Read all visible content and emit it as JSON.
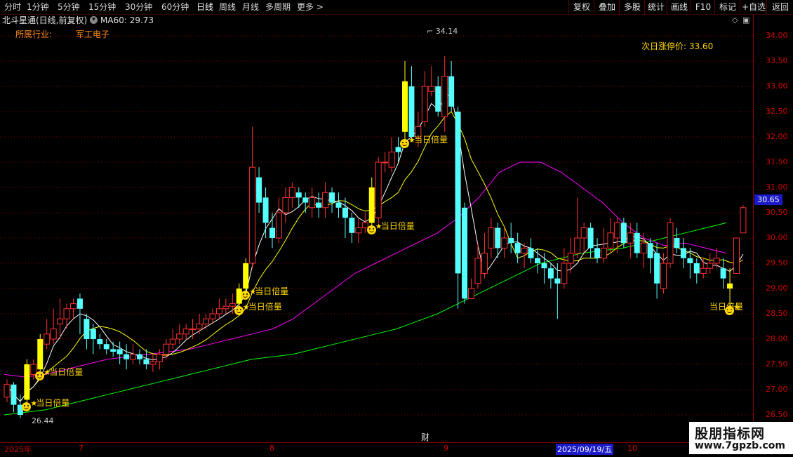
{
  "toolbar": {
    "periods": [
      "分时",
      "1分钟",
      "5分钟",
      "15分钟",
      "30分钟",
      "60分钟",
      "日线",
      "周线",
      "月线",
      "多周期",
      "更多 >"
    ],
    "active_period": "日线",
    "right_buttons": [
      "复权",
      "叠加",
      "多股",
      "统计",
      "画线",
      "F10",
      "标记",
      "+自选",
      "返回"
    ]
  },
  "title": {
    "stock": "北斗星通(日线,前复权)",
    "ma_label": "MA60: 29.73"
  },
  "industry": {
    "label": "所属行业:",
    "value": "军工电子"
  },
  "limit_up": {
    "label": "次日涨停价: 33.60"
  },
  "annotations": {
    "signal_label": "当日倍量",
    "high_label": "34.14",
    "low_label": "26.44",
    "finance_marker": "财"
  },
  "y_axis": {
    "ticks": [
      "34.00",
      "33.50",
      "33.00",
      "32.50",
      "32.00",
      "31.50",
      "31.00",
      "30.50",
      "30.00",
      "29.50",
      "29.00",
      "28.50",
      "28.00",
      "27.50",
      "27.00",
      "26.50"
    ],
    "current_price": "30.65"
  },
  "x_axis": {
    "labels": [
      "2025年",
      "7",
      "8",
      "9",
      "2025/09/19/五",
      "10"
    ]
  },
  "watermark": {
    "title": "股朋指标网",
    "url": "www.7gpzb.com"
  },
  "colors": {
    "up": "#ff3232",
    "down": "#54ffff",
    "signal": "#ffff00",
    "ma5": "#ffffff",
    "ma10": "#ffff00",
    "ma20": "#ff00ff",
    "ma60": "#00ff00",
    "grid": "#8b0000"
  },
  "chart_data": {
    "type": "candlestick",
    "ylim": [
      26.4,
      34.2
    ],
    "candles": [
      [
        26.85,
        27.1,
        27.2,
        26.75
      ],
      [
        27.1,
        26.7,
        27.15,
        26.55
      ],
      [
        26.7,
        26.5,
        26.9,
        26.44
      ],
      [
        26.8,
        27.5,
        27.6,
        26.7
      ],
      [
        27.3,
        27.5,
        27.6,
        27.2
      ],
      [
        27.4,
        28.0,
        28.1,
        27.3
      ],
      [
        27.9,
        28.1,
        28.4,
        27.8
      ],
      [
        28.0,
        28.2,
        28.6,
        27.9
      ],
      [
        28.3,
        28.4,
        28.8,
        28.0
      ],
      [
        28.4,
        28.6,
        28.7,
        28.2
      ],
      [
        28.6,
        28.7,
        28.8,
        28.4
      ],
      [
        28.8,
        28.6,
        28.9,
        28.1
      ],
      [
        28.4,
        28.0,
        28.5,
        27.8
      ],
      [
        28.2,
        28.0,
        28.3,
        27.7
      ],
      [
        28.0,
        27.9,
        28.1,
        27.8
      ],
      [
        27.9,
        27.8,
        28.0,
        27.7
      ],
      [
        27.8,
        27.75,
        27.95,
        27.65
      ],
      [
        27.8,
        27.7,
        27.95,
        27.5
      ],
      [
        27.7,
        27.6,
        27.9,
        27.4
      ],
      [
        27.6,
        27.7,
        27.9,
        27.5
      ],
      [
        27.7,
        27.6,
        27.8,
        27.5
      ],
      [
        27.6,
        27.5,
        27.8,
        27.4
      ],
      [
        27.5,
        27.55,
        27.7,
        27.35
      ],
      [
        27.55,
        27.7,
        27.8,
        27.4
      ],
      [
        27.7,
        27.9,
        28.0,
        27.6
      ],
      [
        27.9,
        28.0,
        28.2,
        27.8
      ],
      [
        28.0,
        28.1,
        28.3,
        27.9
      ],
      [
        28.1,
        28.2,
        28.3,
        28.0
      ],
      [
        28.2,
        28.2,
        28.4,
        28.0
      ],
      [
        28.2,
        28.3,
        28.5,
        28.1
      ],
      [
        28.3,
        28.4,
        28.5,
        28.2
      ],
      [
        28.4,
        28.5,
        28.6,
        28.3
      ],
      [
        28.5,
        28.6,
        28.8,
        28.4
      ],
      [
        28.6,
        28.65,
        28.8,
        28.5
      ],
      [
        28.65,
        28.7,
        28.9,
        28.5
      ],
      [
        28.7,
        29.0,
        29.1,
        28.6
      ],
      [
        29.0,
        29.5,
        29.6,
        28.9
      ],
      [
        29.5,
        31.4,
        32.2,
        29.4
      ],
      [
        31.2,
        30.7,
        31.4,
        30.5
      ],
      [
        30.8,
        30.3,
        31.0,
        30.0
      ],
      [
        30.2,
        30.0,
        30.5,
        29.8
      ],
      [
        30.0,
        30.5,
        30.8,
        29.9
      ],
      [
        30.5,
        30.8,
        31.0,
        30.3
      ],
      [
        30.8,
        31.0,
        31.1,
        30.6
      ],
      [
        30.9,
        30.8,
        31.0,
        30.6
      ],
      [
        30.8,
        30.7,
        30.9,
        30.5
      ],
      [
        30.6,
        30.8,
        31.0,
        30.4
      ],
      [
        30.7,
        30.6,
        30.9,
        30.4
      ],
      [
        30.6,
        30.9,
        31.1,
        30.4
      ],
      [
        30.9,
        30.7,
        31.0,
        30.5
      ],
      [
        30.7,
        30.6,
        30.9,
        30.4
      ],
      [
        30.6,
        30.4,
        30.8,
        30.0
      ],
      [
        30.4,
        30.1,
        30.5,
        29.9
      ],
      [
        30.1,
        30.2,
        30.4,
        29.9
      ],
      [
        30.2,
        30.3,
        30.5,
        30.1
      ],
      [
        30.3,
        31.0,
        31.2,
        30.2
      ],
      [
        30.4,
        31.5,
        31.6,
        30.3
      ],
      [
        31.5,
        31.5,
        31.7,
        31.3
      ],
      [
        31.4,
        31.7,
        32.0,
        31.3
      ],
      [
        31.8,
        31.7,
        32.0,
        31.5
      ],
      [
        32.1,
        33.1,
        33.5,
        31.9
      ],
      [
        33.0,
        32.0,
        33.4,
        31.9
      ],
      [
        32.0,
        32.2,
        32.5,
        31.8
      ],
      [
        32.3,
        33.0,
        33.3,
        32.2
      ],
      [
        32.9,
        33.0,
        33.4,
        32.8
      ],
      [
        33.0,
        32.5,
        33.2,
        32.4
      ],
      [
        32.4,
        33.2,
        33.6,
        32.1
      ],
      [
        33.2,
        32.6,
        33.5,
        32.5
      ],
      [
        32.5,
        29.3,
        32.6,
        28.6
      ],
      [
        30.6,
        28.8,
        30.7,
        28.7
      ],
      [
        28.8,
        29.0,
        29.2,
        28.8
      ],
      [
        29.1,
        29.6,
        29.9,
        29.0
      ],
      [
        29.3,
        29.7,
        30.1,
        29.2
      ],
      [
        29.8,
        30.2,
        30.4,
        29.6
      ],
      [
        30.2,
        29.8,
        30.3,
        29.6
      ],
      [
        29.8,
        30.0,
        30.2,
        29.6
      ],
      [
        30.0,
        29.9,
        30.3,
        29.7
      ],
      [
        29.9,
        29.7,
        30.1,
        29.5
      ],
      [
        29.7,
        29.8,
        29.9,
        29.4
      ],
      [
        29.8,
        29.6,
        30.0,
        29.5
      ],
      [
        29.6,
        29.5,
        29.8,
        29.3
      ],
      [
        29.5,
        29.4,
        29.7,
        29.1
      ],
      [
        29.4,
        29.2,
        29.5,
        29.0
      ],
      [
        29.2,
        29.1,
        29.5,
        28.4
      ],
      [
        29.1,
        29.5,
        29.8,
        29.0
      ],
      [
        29.5,
        29.7,
        30.0,
        29.3
      ],
      [
        29.7,
        30.0,
        30.8,
        29.6
      ],
      [
        30.0,
        30.2,
        30.3,
        29.7
      ],
      [
        30.2,
        29.8,
        30.3,
        29.6
      ],
      [
        29.8,
        29.6,
        30.0,
        29.5
      ],
      [
        29.6,
        29.8,
        30.2,
        29.5
      ],
      [
        29.8,
        30.1,
        30.4,
        29.7
      ],
      [
        30.0,
        30.3,
        30.4,
        29.7
      ],
      [
        30.3,
        29.9,
        30.4,
        29.8
      ],
      [
        29.9,
        30.1,
        30.3,
        29.6
      ],
      [
        30.1,
        29.7,
        30.3,
        29.6
      ],
      [
        29.7,
        29.9,
        30.1,
        29.4
      ],
      [
        29.9,
        29.6,
        30.0,
        29.3
      ],
      [
        29.7,
        29.1,
        29.9,
        28.8
      ],
      [
        29.0,
        29.5,
        29.7,
        28.9
      ],
      [
        29.5,
        30.3,
        30.4,
        29.4
      ],
      [
        30.0,
        29.8,
        30.2,
        29.7
      ],
      [
        29.8,
        29.6,
        30.0,
        29.4
      ],
      [
        29.6,
        29.5,
        29.8,
        29.2
      ],
      [
        29.5,
        29.3,
        29.6,
        29.1
      ],
      [
        29.3,
        29.4,
        29.6,
        29.2
      ],
      [
        29.4,
        29.5,
        29.7,
        29.3
      ],
      [
        29.5,
        29.6,
        29.8,
        29.4
      ],
      [
        29.4,
        29.2,
        29.6,
        29.0
      ],
      [
        29.1,
        29.0,
        29.4,
        28.6
      ],
      [
        29.3,
        30.0,
        30.0,
        29.3
      ],
      [
        30.1,
        30.6,
        30.65,
        30.1
      ]
    ],
    "signal_bars": [
      3,
      5,
      35,
      36,
      55,
      60,
      109
    ],
    "ma60": [
      26.5,
      26.55,
      26.6,
      26.7,
      26.8,
      26.9,
      27.0,
      27.1,
      27.2,
      27.3,
      27.4,
      27.5,
      27.6,
      27.65,
      27.7,
      27.8,
      27.9,
      28.0,
      28.1,
      28.2,
      28.35,
      28.5,
      28.7,
      28.9,
      29.1,
      29.3,
      29.5,
      29.6,
      29.7,
      29.75,
      29.8,
      29.9,
      30.0,
      30.1,
      30.2,
      30.3
    ],
    "ma20": [
      27.3,
      27.25,
      27.3,
      27.4,
      27.5,
      27.6,
      27.65,
      27.7,
      27.75,
      27.8,
      27.9,
      28.0,
      28.1,
      28.2,
      28.4,
      28.7,
      29.0,
      29.3,
      29.5,
      29.7,
      29.9,
      30.1,
      30.4,
      30.8,
      31.3,
      31.5,
      31.5,
      31.3,
      31.0,
      30.7,
      30.3,
      30.0,
      29.85,
      29.9,
      29.8,
      29.7
    ]
  }
}
